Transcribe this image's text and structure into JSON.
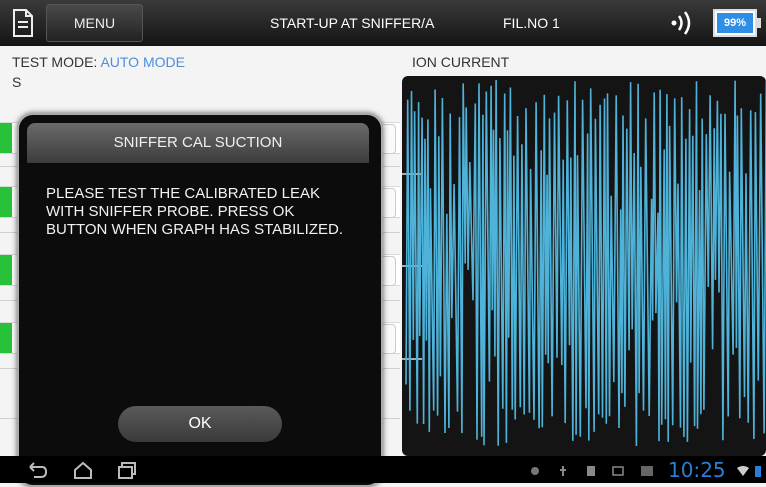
{
  "topbar": {
    "menu_label": "MENU",
    "title": "START-UP AT SNIFFER/A",
    "filament": "FIL.NO 1",
    "battery_percent": "99%",
    "battery_level": 0.99
  },
  "main": {
    "test_mode_label": "TEST MODE:",
    "test_mode_value": "AUTO MODE",
    "s_label": "S",
    "ion_current_label": "ION CURRENT"
  },
  "dialog": {
    "title": "SNIFFER CAL SUCTION",
    "message": "PLEASE TEST THE CALIBRATED LEAK WITH SNIFFER PROBE. PRESS OK BUTTON WHEN GRAPH HAS STABILIZED.",
    "ok_label": "OK"
  },
  "statusbar": {
    "time": "10:25"
  },
  "colors": {
    "accent": "#2e8fe6",
    "status_green": "#27c23a",
    "graph_line": "#4fb3d9",
    "mode_value": "#4d8fd6"
  }
}
